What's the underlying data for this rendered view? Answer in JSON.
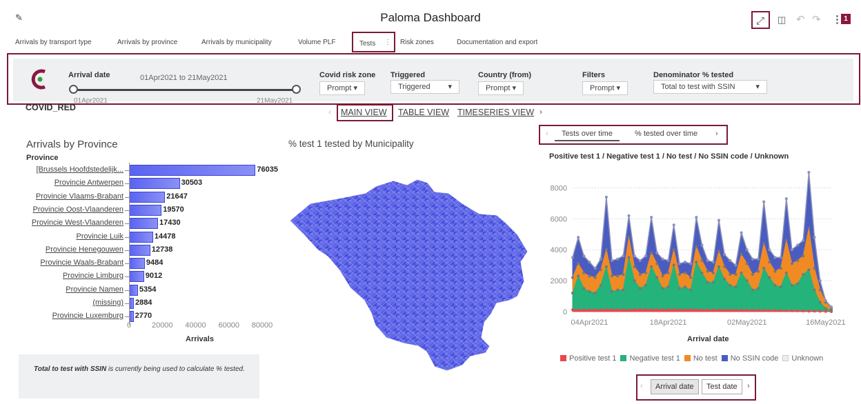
{
  "app": {
    "title": "Paloma Dashboard",
    "badge": "1"
  },
  "tabs": [
    "Arrivals by transport type",
    "Arrivals by province",
    "Arrivals by municipality",
    "Volume PLF",
    "Tests",
    "Risk zones",
    "Documentation and export"
  ],
  "filters": {
    "arrival_date_label": "Arrival date",
    "arrival_date_range": "01Apr2021 to 21May2021",
    "slider_start": "01Apr2021",
    "slider_end": "21May2021",
    "covid_risk_zone_label": "Covid risk zone",
    "covid_risk_zone_value": "Prompt",
    "triggered_label": "Triggered",
    "triggered_value": "Triggered",
    "country_label": "Country (from)",
    "country_value": "Prompt",
    "filters_label": "Filters",
    "filters_value": "Prompt",
    "denominator_label": "Denominator % tested",
    "denominator_value": "Total to test with SSIN"
  },
  "section_label": "COVID_RED",
  "views": [
    "MAIN VIEW",
    "TABLE VIEW",
    "TIMESERIES VIEW"
  ],
  "left_chart": {
    "title": "Arrivals by Province",
    "category_header": "Province",
    "xlabel": "Arrivals",
    "note_bold": "Total to test with SSIN",
    "note_rest": " is currently being used to calculate % tested.",
    "chart_data": {
      "type": "bar",
      "categories": [
        "[Brussels Hoofdstedelijk...",
        "Provincie Antwerpen",
        "Provincie Vlaams-Brabant",
        "Provincie Oost-Vlaanderen",
        "Provincie West-Vlaanderen",
        "Provincie Luik",
        "Provincie Henegouwen",
        "Provincie Waals-Brabant",
        "Provincie Limburg",
        "Provincie Namen",
        "(missing)",
        "Provincie Luxemburg"
      ],
      "values": [
        76035,
        30503,
        21647,
        19570,
        17430,
        14478,
        12738,
        9484,
        9012,
        5354,
        2884,
        2770
      ],
      "xlim": [
        0,
        80000
      ],
      "xticks": [
        "0",
        "20000",
        "40000",
        "60000",
        "80000"
      ]
    }
  },
  "map": {
    "title": "% test 1 tested by Municipality"
  },
  "right_chart": {
    "subtabs": [
      "Tests over time",
      "% tested over time"
    ],
    "title": "Positive test 1 / Negative test 1 / No test / No SSIN code / Unknown",
    "xlabel": "Arrival date",
    "bottom_toggle": [
      "Arrival date",
      "Test date"
    ],
    "chart_data": {
      "type": "area",
      "x_ticks": [
        "04Apr2021",
        "18Apr2021",
        "02May2021",
        "16May2021"
      ],
      "y_ticks": [
        "0",
        "2000",
        "4000",
        "6000",
        "8000"
      ],
      "ylim": [
        0,
        9000
      ],
      "series": [
        {
          "name": "Positive test 1",
          "color": "#e8474f",
          "values": [
            120,
            100,
            100,
            110,
            110,
            100,
            130,
            120,
            120,
            100,
            110,
            130,
            140,
            120,
            120,
            120,
            110,
            120,
            130,
            110,
            110,
            120,
            110,
            100,
            100,
            100,
            90,
            100,
            90,
            90,
            90,
            90,
            80,
            80,
            80,
            70,
            60,
            60,
            60,
            50,
            50,
            40,
            30,
            30,
            20,
            10,
            0
          ]
        },
        {
          "name": "Negative test 1",
          "color": "#24b37a",
          "values": [
            1200,
            2300,
            1500,
            1300,
            1200,
            1700,
            2900,
            1300,
            1400,
            1400,
            3500,
            2000,
            1500,
            1700,
            2900,
            2200,
            1500,
            1600,
            3000,
            1500,
            1600,
            1400,
            3200,
            2500,
            1900,
            1900,
            2900,
            2100,
            1700,
            1600,
            2500,
            2000,
            1400,
            1500,
            2800,
            2200,
            1700,
            1600,
            2500,
            1700,
            1800,
            2400,
            2700,
            1400,
            600,
            200,
            100
          ]
        },
        {
          "name": "No test",
          "color": "#f08a24",
          "values": [
            2200,
            3100,
            2500,
            2300,
            2200,
            2700,
            4000,
            2300,
            2300,
            2400,
            4800,
            2900,
            2400,
            2500,
            3800,
            3100,
            2300,
            2500,
            4000,
            2400,
            2500,
            2200,
            4200,
            3300,
            2600,
            2500,
            3900,
            2900,
            2400,
            2400,
            3700,
            3100,
            2400,
            2600,
            4400,
            3200,
            2600,
            2800,
            4600,
            3100,
            3300,
            3600,
            5400,
            2800,
            1400,
            600,
            200
          ]
        },
        {
          "name": "No SSIN code",
          "color": "#4a5cc0",
          "values": [
            3500,
            4800,
            3600,
            3200,
            2800,
            3400,
            7400,
            3300,
            3400,
            3600,
            6200,
            3600,
            3300,
            3600,
            6100,
            3800,
            3400,
            3300,
            5600,
            3100,
            3200,
            3100,
            6100,
            4300,
            3300,
            3200,
            5900,
            3700,
            3300,
            3000,
            5100,
            4000,
            3400,
            3400,
            7100,
            4000,
            3500,
            3500,
            7300,
            4000,
            4300,
            4600,
            9000,
            4800,
            2000,
            700,
            300
          ]
        },
        {
          "name": "Unknown",
          "color": "#eeeeee",
          "values": []
        }
      ]
    }
  }
}
